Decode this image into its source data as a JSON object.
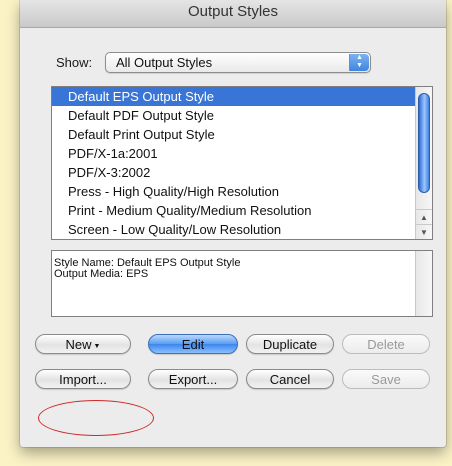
{
  "window": {
    "title": "Output Styles"
  },
  "filter": {
    "label": "Show:",
    "selected": "All Output Styles",
    "stepper_icon": "popup-stepper-icon"
  },
  "styles_list": {
    "items": [
      {
        "label": "Default EPS Output Style",
        "selected": true
      },
      {
        "label": "Default PDF Output Style",
        "selected": false
      },
      {
        "label": "Default Print Output Style",
        "selected": false
      },
      {
        "label": "PDF/X-1a:2001",
        "selected": false
      },
      {
        "label": "PDF/X-3:2002",
        "selected": false
      },
      {
        "label": "Press - High Quality/High Resolution",
        "selected": false
      },
      {
        "label": "Print - Medium Quality/Medium Resolution",
        "selected": false
      },
      {
        "label": "Screen - Low Quality/Low Resolution",
        "selected": false
      }
    ]
  },
  "details": {
    "line1": "Style Name: Default EPS Output Style",
    "line2": "Output Media: EPS"
  },
  "buttons": {
    "new": "New",
    "edit": "Edit",
    "duplicate": "Duplicate",
    "delete": "Delete",
    "import": "Import...",
    "export": "Export...",
    "cancel": "Cancel",
    "save": "Save"
  },
  "colors": {
    "selection": "#3875d7",
    "annotation": "#cc2a2a",
    "background": "#fbf3c6"
  }
}
